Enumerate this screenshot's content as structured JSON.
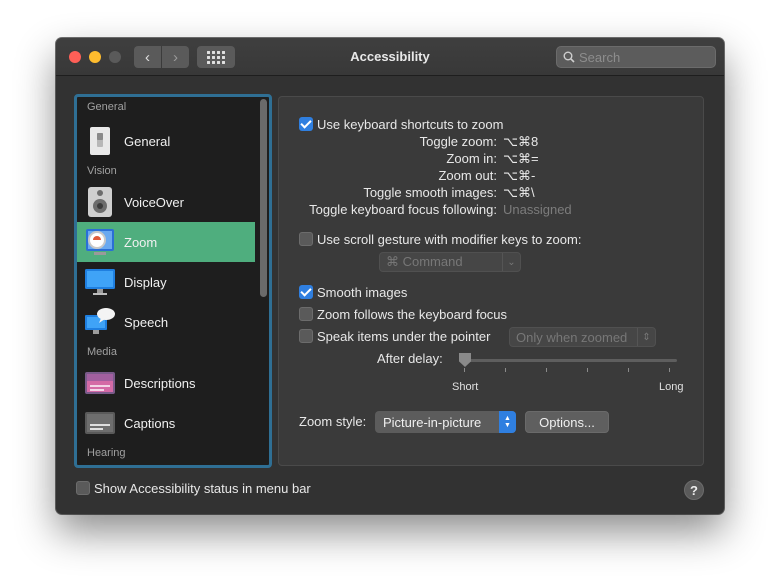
{
  "window": {
    "title": "Accessibility"
  },
  "search": {
    "placeholder": "Search",
    "icon": "magnifier"
  },
  "sidebar": {
    "sections": [
      "General",
      "Vision",
      "Media",
      "Hearing"
    ],
    "items": [
      {
        "label": "General",
        "icon": "switch-icon"
      },
      {
        "label": "VoiceOver",
        "icon": "speaker-icon"
      },
      {
        "label": "Zoom",
        "icon": "magnifier-icon",
        "selected": true
      },
      {
        "label": "Display",
        "icon": "monitor-icon"
      },
      {
        "label": "Speech",
        "icon": "speech-bubble-icon"
      },
      {
        "label": "Descriptions",
        "icon": "descriptions-icon"
      },
      {
        "label": "Captions",
        "icon": "captions-icon"
      }
    ]
  },
  "zoom": {
    "keyboard_shortcuts": {
      "label": "Use keyboard shortcuts to zoom",
      "checked": true
    },
    "shortcuts": [
      {
        "name": "Toggle zoom:",
        "keys": "⌥⌘8"
      },
      {
        "name": "Zoom in:",
        "keys": "⌥⌘="
      },
      {
        "name": "Zoom out:",
        "keys": "⌥⌘-"
      },
      {
        "name": "Toggle smooth images:",
        "keys": "⌥⌘\\"
      },
      {
        "name": "Toggle keyboard focus following:",
        "keys": "Unassigned"
      }
    ],
    "scroll_gesture": {
      "label": "Use scroll gesture with modifier keys to zoom:",
      "checked": false,
      "modifier": "⌘ Command"
    },
    "smooth_images": {
      "label": "Smooth images",
      "checked": true
    },
    "follow_focus": {
      "label": "Zoom follows the keyboard focus",
      "checked": false
    },
    "speak_items": {
      "label": "Speak items under the pointer",
      "checked": false,
      "option": "Only when zoomed"
    },
    "delay": {
      "label": "After delay:",
      "min_label": "Short",
      "max_label": "Long",
      "value": 0
    },
    "style": {
      "label": "Zoom style:",
      "value": "Picture-in-picture"
    },
    "options_button": "Options..."
  },
  "footer": {
    "status_checkbox": "Show Accessibility status in menu bar",
    "checked": false,
    "help": "?"
  },
  "colors": {
    "accent": "#2f7fe0",
    "selection": "#4fae7e",
    "sidebar_focus": "#2f6f94"
  }
}
